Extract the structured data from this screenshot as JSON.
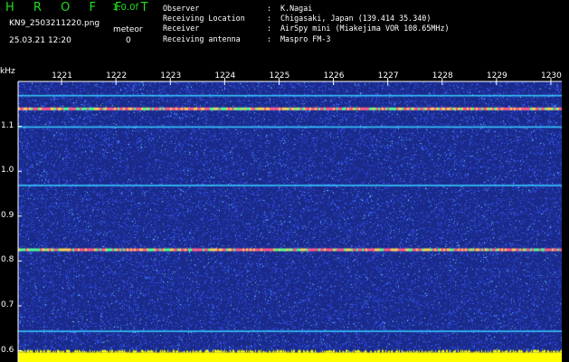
{
  "header": {
    "app_name": "H R O F F T",
    "version": "1.0.0f",
    "filename": "KN9_2503211220.png",
    "timestamp": "25.03.21 12:20",
    "meteor_label": "meteor",
    "meteor_count": "0"
  },
  "info": {
    "rows": [
      {
        "label": "Observer",
        "sep": ":",
        "value": "K.Nagai"
      },
      {
        "label": "Receiving Location",
        "sep": ":",
        "value": "Chigasaki, Japan (139.414 35.340)"
      },
      {
        "label": "Receiver",
        "sep": ":",
        "value": "AirSpy mini (Miakejima VOR 108.65MHz)"
      },
      {
        "label": "Receiving antenna",
        "sep": ":",
        "value": "Maspro FM-3"
      }
    ]
  },
  "chart_data": {
    "type": "heatmap",
    "ylabel": "kHz",
    "y_ticks": [
      "1.1",
      "1.0",
      "0.9",
      "0.8",
      "0.7",
      "0.6"
    ],
    "y_tick_values": [
      1.1,
      1.0,
      0.9,
      0.8,
      0.7,
      0.6
    ],
    "ylim": [
      0.6,
      1.2
    ],
    "x_ticks": [
      "1221",
      "1222",
      "1223",
      "1224",
      "1225",
      "1226",
      "1227",
      "1228",
      "1229",
      "1230"
    ],
    "x_tick_values": [
      1221,
      1222,
      1223,
      1224,
      1225,
      1226,
      1227,
      1228,
      1229,
      1230
    ],
    "xlim": [
      1220.2,
      1230.2
    ],
    "signal_lines_khz": [
      1.17,
      1.14,
      1.1,
      0.97,
      0.826,
      0.645
    ],
    "colors": {
      "background": "#1a2a8a",
      "noise": "#3a5cff",
      "line": "#35c8ff",
      "strong_line": "#ff5a8a",
      "bottom_band": "#ffff00",
      "text": "#ffffff",
      "title": "#22dd22"
    }
  }
}
